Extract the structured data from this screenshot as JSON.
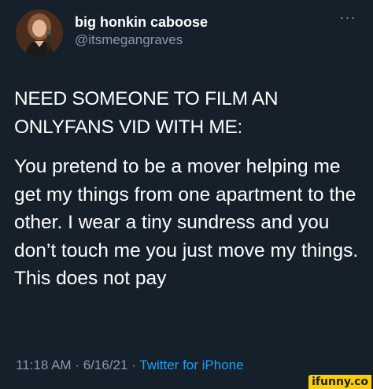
{
  "tweet": {
    "display_name": "big honkin caboose",
    "handle": "@itsmegangraves",
    "more_icon": "more-horizontal-icon",
    "paragraphs": [
      "NEED SOMEONE TO FILM AN ONLYFANS VID WITH ME:",
      "You pretend to be a mover helping me get my things from one apartment to the other. I wear a tiny sundress and you don’t touch me you just move my things. This does not pay"
    ],
    "time": "11:18 AM",
    "separator": "·",
    "date": "6/16/21",
    "source": "Twitter for iPhone"
  },
  "watermark": {
    "text": "ifunny.co",
    "color": "#ffcc00"
  },
  "colors": {
    "background": "#15202b",
    "text": "#ffffff",
    "secondary": "#8899a6",
    "link": "#1da1f2"
  }
}
